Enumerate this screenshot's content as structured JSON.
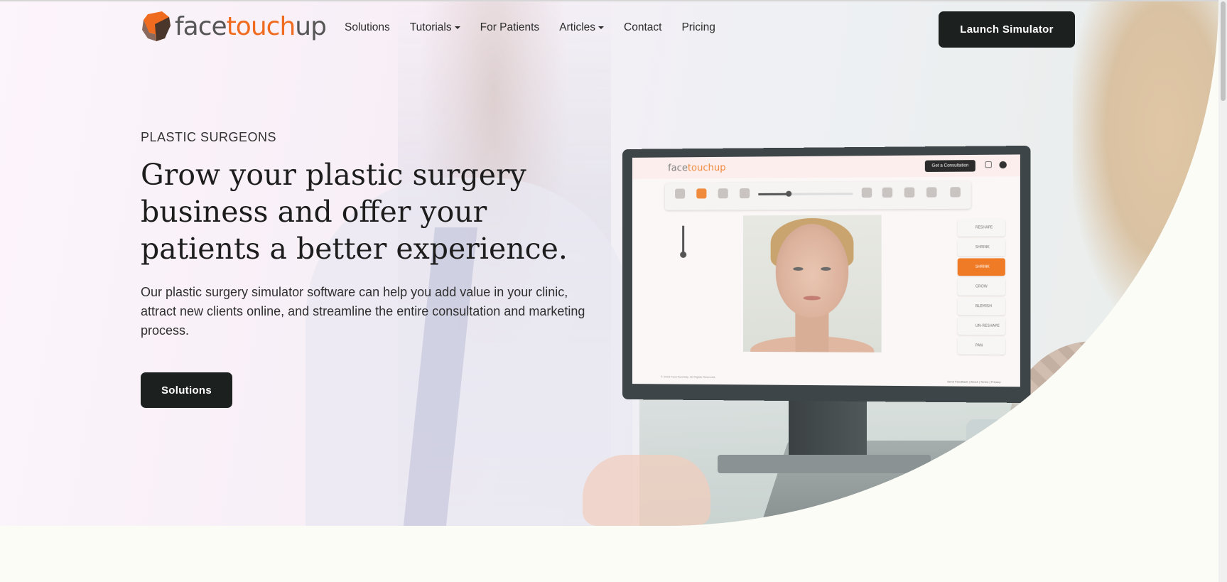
{
  "brand": {
    "logo_text_gray_a": "face",
    "logo_text_orange": "touch",
    "logo_text_gray_b": "up",
    "accent_color": "#ef6b1f",
    "dark_color": "#1c211f"
  },
  "nav": {
    "items": [
      {
        "label": "Solutions",
        "has_dropdown": false
      },
      {
        "label": "Tutorials",
        "has_dropdown": true
      },
      {
        "label": "For Patients",
        "has_dropdown": false
      },
      {
        "label": "Articles",
        "has_dropdown": true
      },
      {
        "label": "Contact",
        "has_dropdown": false
      },
      {
        "label": "Pricing",
        "has_dropdown": false
      }
    ],
    "cta_label": "Launch Simulator"
  },
  "hero": {
    "eyebrow": "PLASTIC SURGEONS",
    "headline": "Grow your plastic surgery business and offer your patients a better experience.",
    "lead": "Our plastic surgery simulator software can help you add value in your clinic, attract new clients online, and streamline the entire consultation and marketing process.",
    "button_label": "Solutions"
  },
  "simulator_screen": {
    "logo_a": "face",
    "logo_b": "touchup",
    "consult_label": "Get a Consultation",
    "tools": [
      "RESHAPE",
      "SHRINK",
      "SHRINK",
      "GROW",
      "BLEMISH",
      "UN-RESHAPE",
      "PAN"
    ],
    "active_tool_index": 2,
    "footer_left": "© 2023 FaceTouchUp. All Rights Reserved.",
    "footer_right": "Send Feedback | About | Terms | Privacy"
  }
}
